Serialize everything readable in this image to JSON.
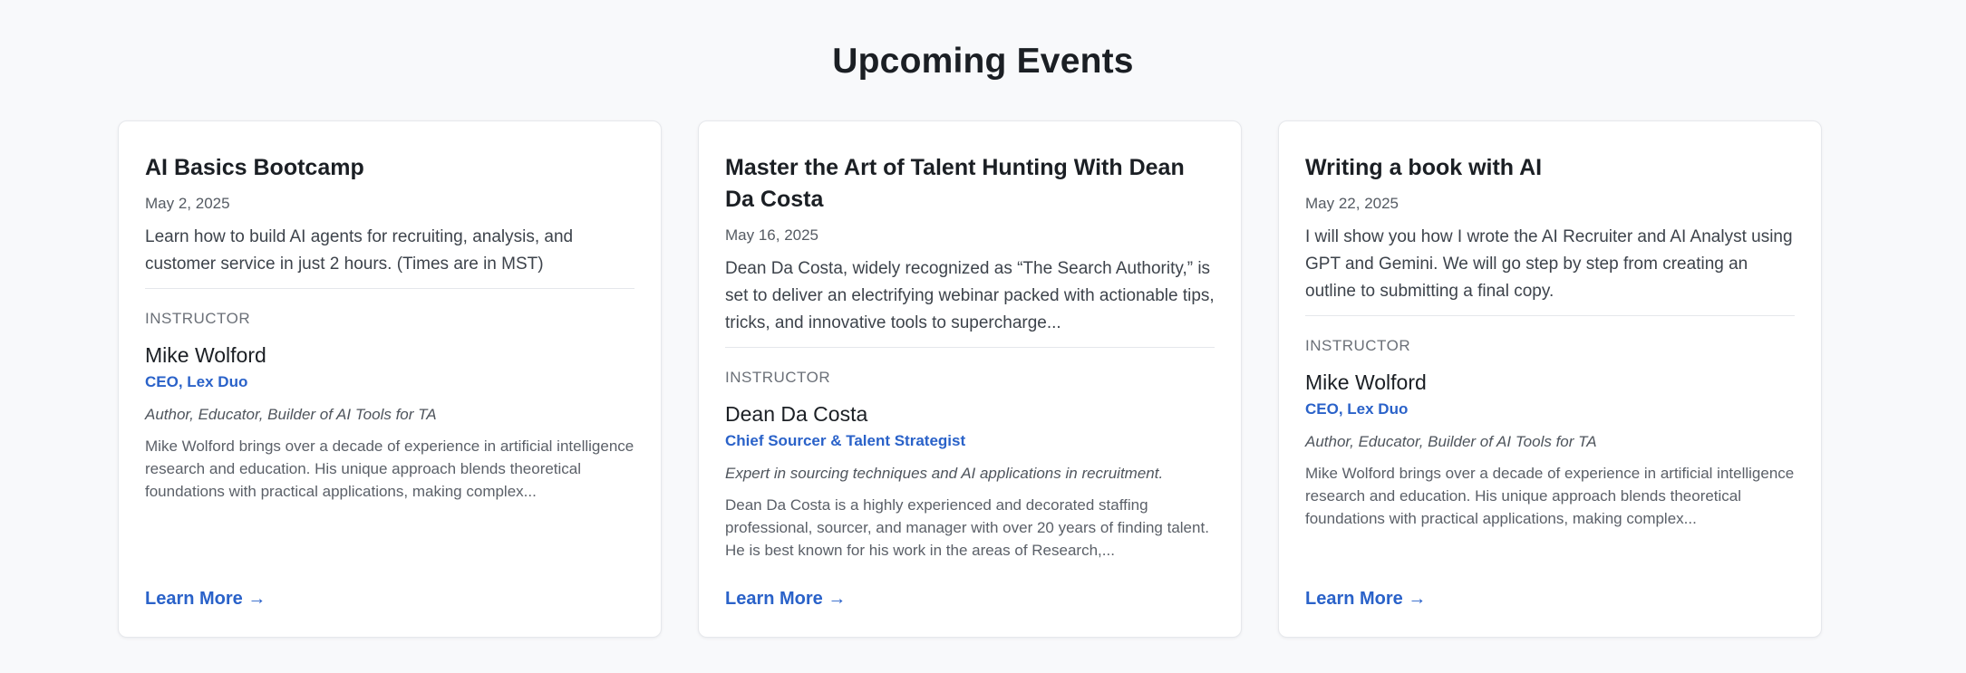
{
  "section": {
    "title": "Upcoming Events"
  },
  "events": [
    {
      "title": "AI Basics Bootcamp",
      "date": "May 2, 2025",
      "description": "Learn how to build AI agents for recruiting, analysis, and customer service in just 2 hours. (Times are in MST)",
      "instructor_label": "INSTRUCTOR",
      "instructor": {
        "name": "Mike Wolford",
        "role": "CEO, Lex Duo",
        "tagline": "Author, Educator, Builder of AI Tools for TA",
        "bio": "Mike Wolford brings over a decade of experience in artificial intelligence research and education. His unique approach blends theoretical foundations with practical applications, making complex..."
      },
      "link_label": "Learn More →"
    },
    {
      "title": "Master the Art of Talent Hunting With Dean Da Costa",
      "date": "May 16, 2025",
      "description": "Dean Da Costa, widely recognized as “The Search Authority,” is set to deliver an electrifying webinar packed with actionable tips, tricks, and innovative tools to supercharge...",
      "instructor_label": "INSTRUCTOR",
      "instructor": {
        "name": "Dean Da Costa",
        "role": "Chief Sourcer & Talent Strategist",
        "tagline": "Expert in sourcing techniques and AI applications in recruitment.",
        "bio": "Dean Da Costa is a highly experienced and decorated staffing professional, sourcer, and manager with over 20 years of finding talent. He is best known for his work in the areas of Research,..."
      },
      "link_label": "Learn More →"
    },
    {
      "title": "Writing a book with AI",
      "date": "May 22, 2025",
      "description": "I will show you how I wrote the AI Recruiter and AI Analyst using GPT and Gemini. We will go step by step from creating an outline to submitting a final copy.",
      "instructor_label": "INSTRUCTOR",
      "instructor": {
        "name": "Mike Wolford",
        "role": "CEO, Lex Duo",
        "tagline": "Author, Educator, Builder of AI Tools for TA",
        "bio": "Mike Wolford brings over a decade of experience in artificial intelligence research and education. His unique approach blends theoretical foundations with practical applications, making complex..."
      },
      "link_label": "Learn More →"
    }
  ],
  "colors": {
    "accent": "#2a62c9",
    "background": "#f8f9fb",
    "card": "#ffffff"
  }
}
